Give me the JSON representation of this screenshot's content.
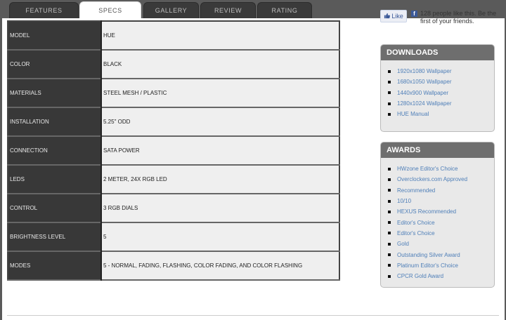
{
  "tabs": [
    {
      "label": "FEATURES",
      "active": false
    },
    {
      "label": "SPECS",
      "active": true
    },
    {
      "label": "GALLERY",
      "active": false
    },
    {
      "label": "REVIEW",
      "active": false
    },
    {
      "label": "RATING",
      "active": false
    }
  ],
  "specs": [
    {
      "key": "MODEL",
      "value": "HUE"
    },
    {
      "key": "COLOR",
      "value": "BLACK"
    },
    {
      "key": "MATERIALS",
      "value": "STEEL MESH / PLASTIC"
    },
    {
      "key": "INSTALLATION",
      "value": "5.25\" ODD"
    },
    {
      "key": "CONNECTION",
      "value": "SATA POWER"
    },
    {
      "key": "LEDS",
      "value": "2 METER, 24X RGB LED"
    },
    {
      "key": "CONTROL",
      "value": "3 RGB DIALS"
    },
    {
      "key": "BRIGHTNESS LEVEL",
      "value": "5"
    },
    {
      "key": "MODES",
      "value": "5 - NORMAL, FADING, FLASHING, COLOR FADING, AND COLOR FLASHING"
    }
  ],
  "facebook": {
    "like_label": "Like",
    "text": "128 people like this. Be the first of your friends."
  },
  "downloads": {
    "title": "DOWNLOADS",
    "items": [
      "1920x1080 Wallpaper",
      "1680x1050 Wallpaper",
      "1440x900 Wallpaper",
      "1280x1024 Wallpaper",
      "HUE Manual"
    ]
  },
  "awards": {
    "title": "AWARDS",
    "items": [
      "HWzone Editor's Choice",
      "Overclockers.com Approved",
      "Recommended",
      "10/10",
      "HEXUS Recommended",
      "Editor's Choice",
      "Editor's Choice",
      "Gold",
      "Outstanding Silver Award",
      "Platinum Editor's Choice",
      "CPCR Gold Award"
    ]
  },
  "colors": {
    "link": "#4f7fb8",
    "spec_key_bg": "#383838",
    "spec_value_bg": "#efefef",
    "box_head_bg": "#6e6e6e"
  }
}
